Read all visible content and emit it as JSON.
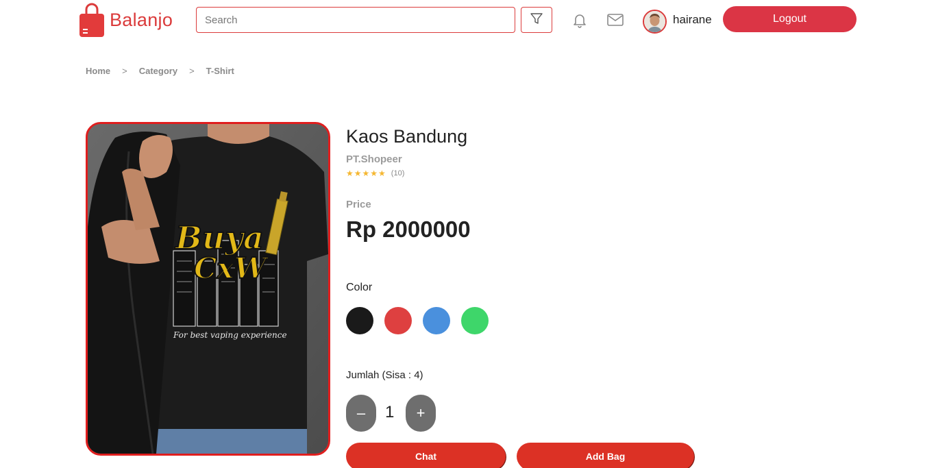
{
  "brand": {
    "name": "Balanjo",
    "color": "#db3b3b"
  },
  "header": {
    "search_placeholder": "Search",
    "username": "hairane",
    "logout_label": "Logout",
    "icons": [
      "filter-icon",
      "bell-icon",
      "mail-icon"
    ]
  },
  "breadcrumb": {
    "items": [
      "Home",
      "Category",
      "T-Shirt"
    ],
    "separator": ">"
  },
  "product": {
    "image_print": {
      "line1": "Buya",
      "line2": "CxW",
      "tagline": "For best vaping experience"
    },
    "title": "Kaos Bandung",
    "store": "PT.Shopeer",
    "rating_stars": 5,
    "rating_count": "(10)",
    "price_label": "Price",
    "price": "Rp 2000000",
    "color_label": "Color",
    "colors": [
      "#1a1a1a",
      "#de4040",
      "#4a90dd",
      "#3ed66a"
    ],
    "quantity_label": "Jumlah (Sisa : 4)",
    "quantity": "1",
    "minus_label": "–",
    "plus_label": "+",
    "chat_label": "Chat",
    "add_bag_label": "Add Bag"
  }
}
